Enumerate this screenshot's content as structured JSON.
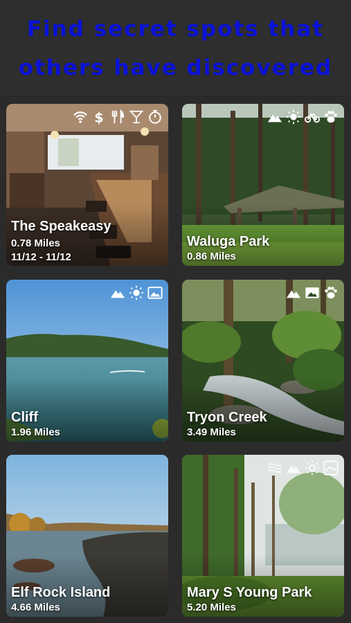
{
  "header": {
    "line1": "Find secret spots that",
    "line2": "others have discovered",
    "color": "#0a12d6"
  },
  "cards": [
    {
      "title": "The Speakeasy",
      "distance": "0.78 Miles",
      "dates": "11/12 - 11/12",
      "icons": [
        "wifi-icon",
        "dollar-icon",
        "fork-knife-icon",
        "cocktail-icon",
        "timer-icon"
      ]
    },
    {
      "title": "Waluga Park",
      "distance": "0.86 Miles",
      "icons": [
        "mountain-icon",
        "sun-icon",
        "bicycle-icon",
        "paw-icon"
      ]
    },
    {
      "title": "Cliff",
      "distance": "1.96 Miles",
      "icons": [
        "mountain-icon",
        "sun-icon",
        "picture-icon"
      ]
    },
    {
      "title": "Tryon Creek",
      "distance": "3.49 Miles",
      "icons": [
        "mountain-icon",
        "picture-icon",
        "paw-icon"
      ]
    },
    {
      "title": "Elf Rock Island",
      "distance": "4.66 Miles",
      "icons": []
    },
    {
      "title": "Mary S Young Park",
      "distance": "5.20 Miles",
      "icons": [
        "water-icon",
        "mountain-icon",
        "sun-icon",
        "picture-icon"
      ]
    }
  ]
}
